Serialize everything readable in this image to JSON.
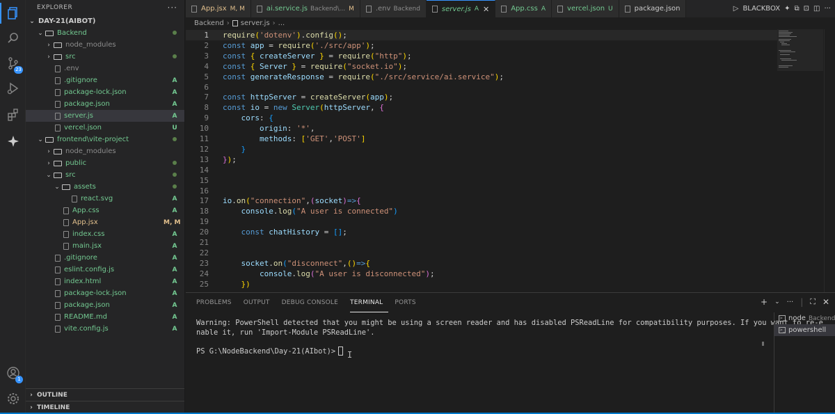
{
  "sidebar": {
    "header": "EXPLORER",
    "more": "···",
    "root": "DAY-21(AIBOT)",
    "items": [
      {
        "label": "Backend",
        "kind": "folder-open",
        "status": "dot",
        "color": "green"
      },
      {
        "label": "node_modules",
        "kind": "folder",
        "status": "",
        "color": "gray"
      },
      {
        "label": "src",
        "kind": "folder",
        "status": "dot",
        "color": "green"
      },
      {
        "label": ".env",
        "kind": "file",
        "status": "",
        "color": "gray"
      },
      {
        "label": ".gitignore",
        "kind": "file",
        "status": "A",
        "color": "green"
      },
      {
        "label": "package-lock.json",
        "kind": "file",
        "status": "A",
        "color": "green"
      },
      {
        "label": "package.json",
        "kind": "file",
        "status": "A",
        "color": "green"
      },
      {
        "label": "server.js",
        "kind": "file",
        "status": "A",
        "color": "green"
      },
      {
        "label": "vercel.json",
        "kind": "file",
        "status": "U",
        "color": "green"
      },
      {
        "label": "frontend\\vite-project",
        "kind": "folder-open",
        "status": "dot",
        "color": "green"
      },
      {
        "label": "node_modules",
        "kind": "folder",
        "status": "",
        "color": "gray"
      },
      {
        "label": "public",
        "kind": "folder",
        "status": "dot",
        "color": "green"
      },
      {
        "label": "src",
        "kind": "folder-open",
        "status": "dot",
        "color": "green"
      },
      {
        "label": "assets",
        "kind": "folder-open",
        "status": "dot",
        "color": "green"
      },
      {
        "label": "react.svg",
        "kind": "file",
        "status": "A",
        "color": "green"
      },
      {
        "label": "App.css",
        "kind": "file",
        "status": "A",
        "color": "green"
      },
      {
        "label": "App.jsx",
        "kind": "file",
        "status": "M, M",
        "color": "yellow"
      },
      {
        "label": "index.css",
        "kind": "file",
        "status": "A",
        "color": "green"
      },
      {
        "label": "main.jsx",
        "kind": "file",
        "status": "A",
        "color": "green"
      },
      {
        "label": ".gitignore",
        "kind": "file",
        "status": "A",
        "color": "green"
      },
      {
        "label": "eslint.config.js",
        "kind": "file",
        "status": "A",
        "color": "green"
      },
      {
        "label": "index.html",
        "kind": "file",
        "status": "A",
        "color": "green"
      },
      {
        "label": "package-lock.json",
        "kind": "file",
        "status": "A",
        "color": "green"
      },
      {
        "label": "package.json",
        "kind": "file",
        "status": "A",
        "color": "green"
      },
      {
        "label": "README.md",
        "kind": "file",
        "status": "A",
        "color": "green"
      },
      {
        "label": "vite.config.js",
        "kind": "file",
        "status": "A",
        "color": "green"
      }
    ],
    "outline": "OUTLINE",
    "timeline": "TIMELINE"
  },
  "activity": {
    "scm_badge": "23",
    "account_badge": "1"
  },
  "tabs": [
    {
      "label": "App.jsx",
      "status": "M, M",
      "sub": "",
      "color": "yellow"
    },
    {
      "label": "ai.service.js",
      "status": "",
      "sub": "Backend\\...",
      "color": "green",
      "status2": "M"
    },
    {
      "label": ".env",
      "status": "",
      "sub": "Backend",
      "color": "gray"
    },
    {
      "label": "server.js",
      "status": "A",
      "sub": "",
      "color": "green",
      "active": true
    },
    {
      "label": "App.css",
      "status": "A",
      "sub": "",
      "color": "green"
    },
    {
      "label": "vercel.json",
      "status": "U",
      "sub": "",
      "color": "green"
    },
    {
      "label": "package.json",
      "status": "",
      "sub": "",
      "color": "white"
    }
  ],
  "tab_actions": {
    "blackbox": "BLACKBOX"
  },
  "breadcrumb": [
    "Backend",
    "server.js",
    "..."
  ],
  "code": [
    {
      "n": "1",
      "html": "<span class=\"f\">require</span><span class=\"br1\">(</span><span class=\"s\">'dotenv'</span><span class=\"br1\">)</span><span class=\"p\">.</span><span class=\"f\">config</span><span class=\"br1\">()</span><span class=\"p\">;</span>"
    },
    {
      "n": "2",
      "html": "<span class=\"k\">const</span> <span class=\"v\">app</span> <span class=\"p\">=</span> <span class=\"f\">require</span><span class=\"br1\">(</span><span class=\"s\">'./src/app'</span><span class=\"br1\">)</span><span class=\"p\">;</span>"
    },
    {
      "n": "3",
      "html": "<span class=\"k\">const</span> <span class=\"br1\">{</span> <span class=\"v\">createServer</span> <span class=\"br1\">}</span> <span class=\"p\">=</span> <span class=\"f\">require</span><span class=\"br1\">(</span><span class=\"s\">\"http\"</span><span class=\"br1\">)</span><span class=\"p\">;</span>"
    },
    {
      "n": "4",
      "html": "<span class=\"k\">const</span> <span class=\"br1\">{</span> <span class=\"v\">Server</span> <span class=\"br1\">}</span> <span class=\"p\">=</span> <span class=\"f\">require</span><span class=\"br1\">(</span><span class=\"s\">\"socket.io\"</span><span class=\"br1\">)</span><span class=\"p\">;</span>"
    },
    {
      "n": "5",
      "html": "<span class=\"k\">const</span> <span class=\"v\">generateResponse</span> <span class=\"p\">=</span> <span class=\"f\">require</span><span class=\"br1\">(</span><span class=\"s\">\"./src/service/ai.service\"</span><span class=\"br1\">)</span><span class=\"p\">;</span>"
    },
    {
      "n": "6",
      "html": ""
    },
    {
      "n": "7",
      "html": "<span class=\"k\">const</span> <span class=\"v\">httpServer</span> <span class=\"p\">=</span> <span class=\"f\">createServer</span><span class=\"br1\">(</span><span class=\"v\">app</span><span class=\"br1\">)</span><span class=\"p\">;</span>"
    },
    {
      "n": "8",
      "html": "<span class=\"k\">const</span> <span class=\"v\">io</span> <span class=\"p\">=</span> <span class=\"k\">new</span> <span class=\"cl\">Server</span><span class=\"br1\">(</span><span class=\"v\">httpServer</span><span class=\"p\">,</span> <span class=\"br2\">{</span>"
    },
    {
      "n": "9",
      "html": "    <span class=\"v\">cors</span><span class=\"p\">:</span> <span class=\"br3\">{</span>"
    },
    {
      "n": "10",
      "html": "        <span class=\"v\">origin</span><span class=\"p\">:</span> <span class=\"s\">'*'</span><span class=\"p\">,</span>"
    },
    {
      "n": "11",
      "html": "        <span class=\"v\">methods</span><span class=\"p\">:</span> <span class=\"br1\">[</span><span class=\"s\">'GET'</span><span class=\"p\">,</span><span class=\"s\">'POST'</span><span class=\"br1\">]</span>"
    },
    {
      "n": "12",
      "html": "    <span class=\"br3\">}</span>"
    },
    {
      "n": "13",
      "html": "<span class=\"br2\">}</span><span class=\"br1\">)</span><span class=\"p\">;</span>"
    },
    {
      "n": "14",
      "html": ""
    },
    {
      "n": "15",
      "html": ""
    },
    {
      "n": "16",
      "html": ""
    },
    {
      "n": "17",
      "html": "<span class=\"v\">io</span><span class=\"p\">.</span><span class=\"f\">on</span><span class=\"br1\">(</span><span class=\"s\">\"connection\"</span><span class=\"p\">,</span><span class=\"br2\">(</span><span class=\"v\">socket</span><span class=\"br2\">)</span><span class=\"k\">=&gt;</span><span class=\"br2\">{</span>"
    },
    {
      "n": "18",
      "html": "    <span class=\"v\">console</span><span class=\"p\">.</span><span class=\"f\">log</span><span class=\"br3\">(</span><span class=\"s\">\"A user is connected\"</span><span class=\"br3\">)</span>"
    },
    {
      "n": "19",
      "html": ""
    },
    {
      "n": "20",
      "html": "    <span class=\"k\">const</span> <span class=\"v\">chatHistory</span> <span class=\"p\">=</span> <span class=\"br3\">[]</span><span class=\"p\">;</span>"
    },
    {
      "n": "21",
      "html": ""
    },
    {
      "n": "22",
      "html": ""
    },
    {
      "n": "23",
      "html": "    <span class=\"v\">socket</span><span class=\"p\">.</span><span class=\"f\">on</span><span class=\"br3\">(</span><span class=\"s\">\"disconnect\"</span><span class=\"p\">,</span><span class=\"br1\">()</span><span class=\"k\">=&gt;</span><span class=\"br1\">{</span>"
    },
    {
      "n": "24",
      "html": "        <span class=\"v\">console</span><span class=\"p\">.</span><span class=\"f\">log</span><span class=\"br2\">(</span><span class=\"s\">\"A user is disconnected\"</span><span class=\"br2\">)</span><span class=\"p\">;</span>"
    },
    {
      "n": "25",
      "html": "    <span class=\"br1\">})</span>"
    }
  ],
  "panel": {
    "tabs": [
      "PROBLEMS",
      "OUTPUT",
      "DEBUG CONSOLE",
      "TERMINAL",
      "PORTS"
    ],
    "active_tab": "TERMINAL",
    "warning_line1": "Warning: PowerShell detected that you might be using a screen reader and has disabled PSReadLine for compatibility purposes. If you want to re-e",
    "warning_line2": "nable it, run 'Import-Module PSReadLine'.",
    "prompt": "PS G:\\NodeBackend\\Day-21(AIbot)>",
    "terminals": [
      {
        "name": "node",
        "sub": "Backend"
      },
      {
        "name": "powershell",
        "sub": ""
      }
    ]
  },
  "colors": {
    "accent": "#007acc",
    "git_added": "#73c991",
    "git_modified": "#e2c08d"
  }
}
